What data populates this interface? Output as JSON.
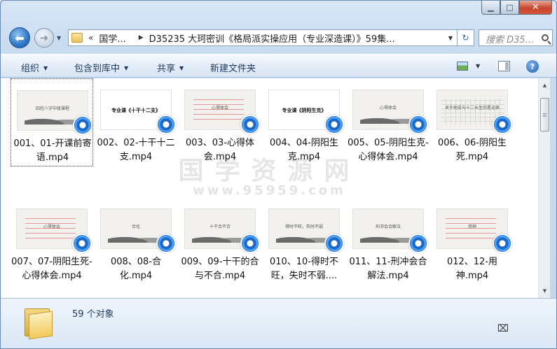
{
  "window": {
    "caption": {
      "minimize": "▁",
      "maximize": "□",
      "close": "✕"
    }
  },
  "nav": {
    "back": "⬅",
    "forward": "➜",
    "recent": "▼",
    "address": {
      "overflow": "«",
      "crumb1": "国学...",
      "separator": "▶",
      "crumb2": "D35235 大珂密训《格局派实操应用（专业深造课）》59集..."
    },
    "refresh": "↻",
    "search_placeholder": "搜索 D35..."
  },
  "toolbar": {
    "organize": "组织",
    "include": "包含到库中",
    "share": "共享",
    "new_folder": "新建文件夹",
    "help": "?"
  },
  "files": [
    {
      "name": "001、01-开课前寄语.mp4",
      "thumb_text": "四柱八字中级课程",
      "thumb_style": "ink",
      "selected": true
    },
    {
      "name": "002、02-十干十二支.mp4",
      "thumb_text": "专业课《十干十二支》",
      "thumb_style": "white"
    },
    {
      "name": "003、03-心得体会.mp4",
      "thumb_text": "心得体会",
      "thumb_style": "handwriting"
    },
    {
      "name": "004、04-阴阳生克.mp4",
      "thumb_text": "专业课《阴阳生克》",
      "thumb_style": "white"
    },
    {
      "name": "005、05-阴阳生克-心得体会.mp4",
      "thumb_text": "心得体会",
      "thumb_style": "ink"
    },
    {
      "name": "006、06-阴阳生死.mp4",
      "thumb_text": "关于地支与十二长生的星运表",
      "thumb_style": "grid"
    },
    {
      "name": "007、07-阴阳生死-心得体会.mp4",
      "thumb_text": "心得体会",
      "thumb_style": "handwriting"
    },
    {
      "name": "008、08-合化.mp4",
      "thumb_text": "合化",
      "thumb_style": "ink"
    },
    {
      "name": "009、09-十干的合与不合.mp4",
      "thumb_text": "十干合不合",
      "thumb_style": "ink"
    },
    {
      "name": "010、10-得时不旺，失时不弱....",
      "thumb_text": "得时不旺，失时不弱",
      "thumb_style": "ink"
    },
    {
      "name": "011、11-刑冲会合解法.mp4",
      "thumb_text": "刑冲会合解法",
      "thumb_style": "ink"
    },
    {
      "name": "012、12-用神.mp4",
      "thumb_text": "用神",
      "thumb_style": "handwriting"
    }
  ],
  "watermark": {
    "title": "国学资源网",
    "url": "www.95959.com"
  },
  "status": {
    "count": "59 个对象"
  },
  "colors": {
    "window_frame": "#c9dcf0",
    "toolbar": "#e4edf8",
    "accent": "#2f76c6",
    "close": "#c7452c"
  }
}
